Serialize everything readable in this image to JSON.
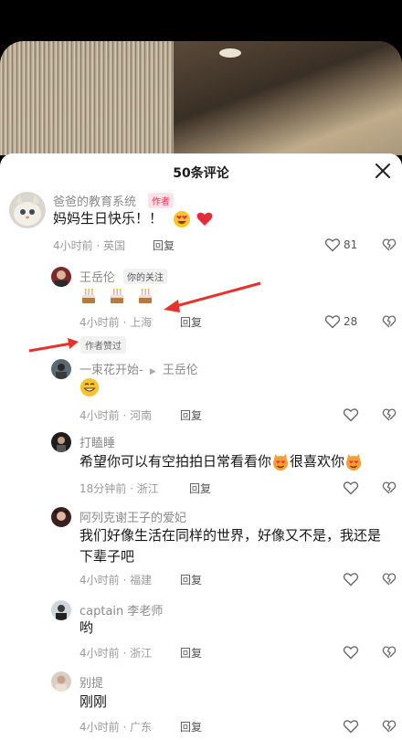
{
  "header": {
    "title": "50条评论",
    "close_icon": "close-icon"
  },
  "comments": [
    {
      "user": "爸爸的教育系统",
      "badge": "作者",
      "text": "妈妈生日快乐！！",
      "time": "4小时前 · 英国",
      "reply": "回复",
      "likes": "81",
      "emoji": [
        "heart-eyes-emoji",
        "red-heart-emoji"
      ]
    },
    {
      "user": "王岳伦",
      "badge": "你的关注",
      "text": "",
      "time": "4小时前 · 上海",
      "reply": "回复",
      "likes": "28",
      "emoji": [
        "cake-emoji",
        "cake-emoji",
        "cake-emoji"
      ]
    },
    {
      "user": "一束花开始-",
      "reply_to": "王岳伦",
      "text": "",
      "time": "4小时前 · 河南",
      "reply": "回复",
      "emoji": [
        "smile-emoji"
      ]
    },
    {
      "user": "打瞌睡",
      "text": "希望你可以有空拍拍日常看看你",
      "text2": "很喜欢你",
      "time": "18分钟前 · 浙江",
      "reply": "回复",
      "emoji": [
        "heart-eyes-cat-emoji",
        "heart-eyes-cat-emoji"
      ]
    },
    {
      "user": "阿列克谢王子的爱妃",
      "text": "我们好像生活在同样的世界，好像又不是，我还是下辈子吧",
      "time": "4小时前 · 福建",
      "reply": "回复"
    },
    {
      "user": "captain 李老师",
      "text": "哟",
      "time": "4小时前 · 浙江",
      "reply": "回复"
    },
    {
      "user": "别提",
      "text": "刚刚",
      "time": "4小时前 · 广东",
      "reply": "回复"
    }
  ],
  "author_liked": "作者赞过",
  "colors": {
    "accent": "#f0305a",
    "muted": "#9a9a9a",
    "arrow": "#e8312a"
  }
}
